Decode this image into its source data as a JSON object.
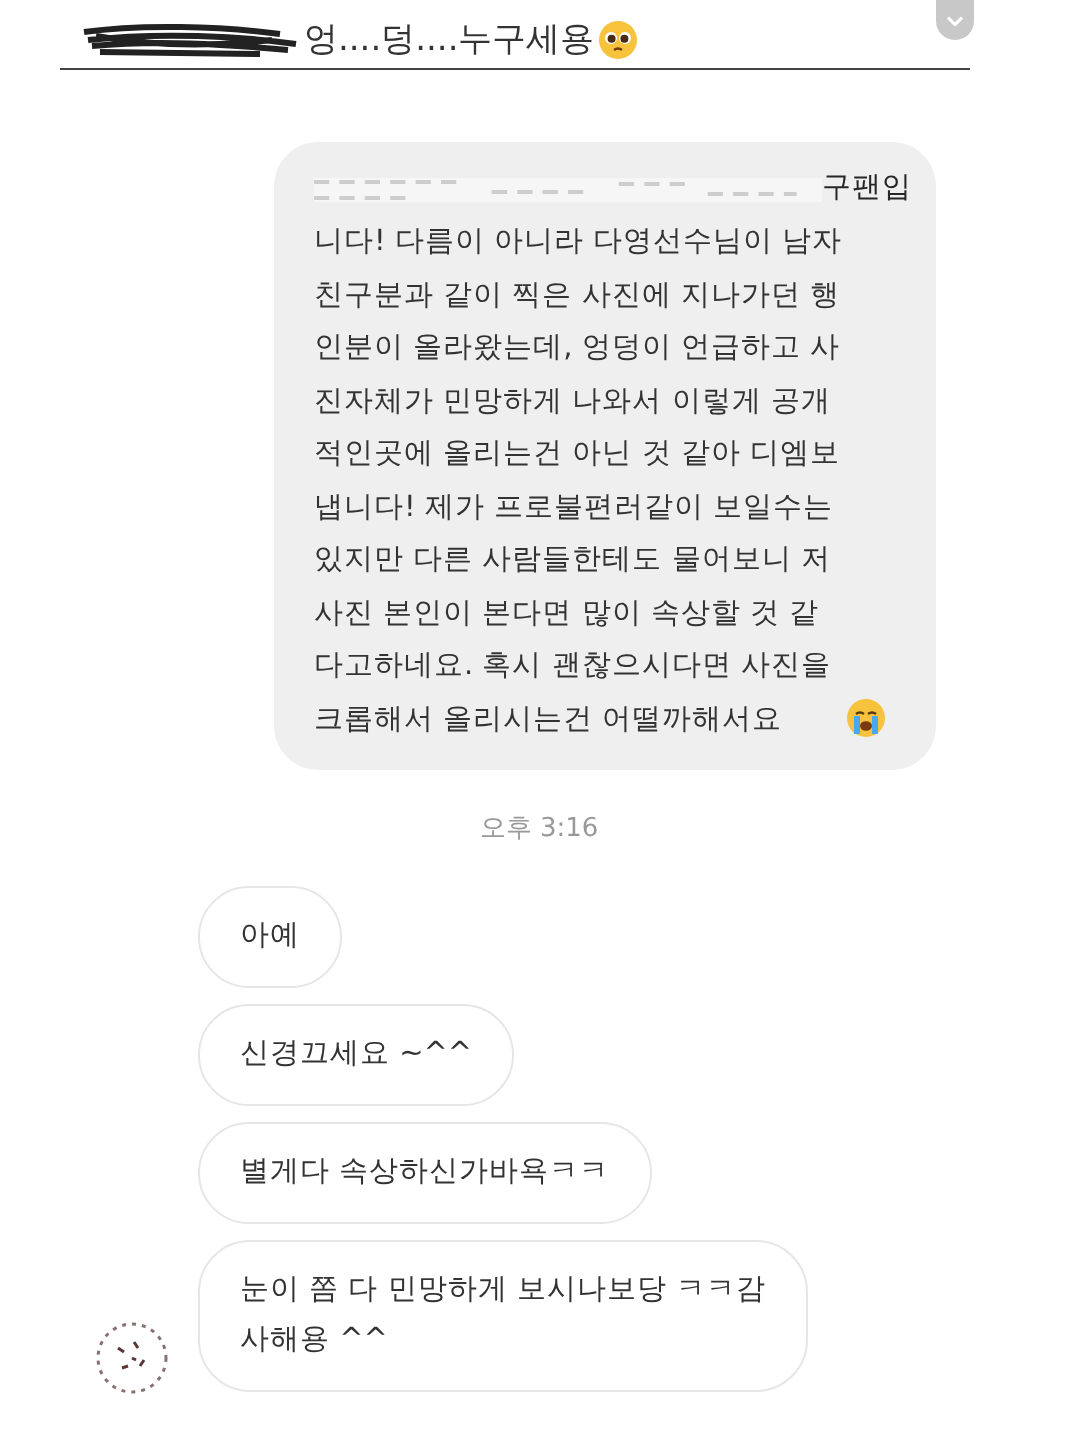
{
  "caption": {
    "text": "엉....덩....누구세용"
  },
  "sent_message": {
    "first_line_end": "구팬입",
    "text": "니다! 다름이 아니라 다영선수님이 남자\n친구분과 같이 찍은 사진에 지나가던 행\n인분이 올라왔는데, 엉덩이 언급하고 사\n진자체가 민망하게 나와서 이렇게 공개\n적인곳에 올리는건 아닌 것 같아 디엠보\n냅니다! 제가 프로불편러같이 보일수는\n있지만 다른 사람들한테도 물어보니 저\n사진 본인이 본다면 많이 속상할 것 같\n다고하네요. 혹시 괜찮으시다면 사진을\n크롭해서 올리시는건 어떨까해서요"
  },
  "timestamp": "오후 3:16",
  "received_messages": [
    {
      "text": "아예"
    },
    {
      "text": "신경끄세요 ~^^"
    },
    {
      "text": "별게다 속상하신가바욕ㅋㅋ"
    },
    {
      "text": "눈이 쫌 다 민망하게 보시나보당 ㅋㅋ감\n사해용 ^^"
    }
  ]
}
